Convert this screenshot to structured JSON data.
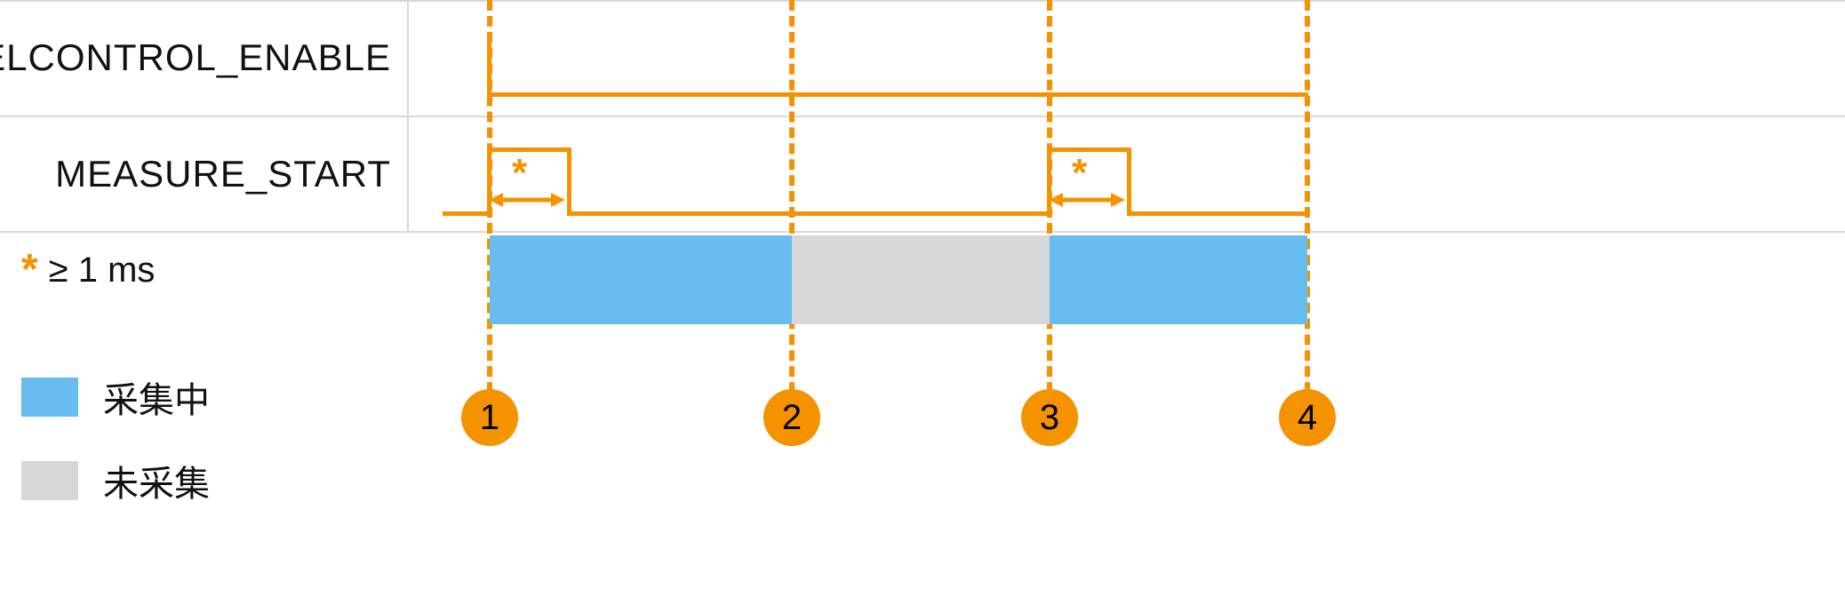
{
  "rows": {
    "levelcontrol_enable": {
      "label": "LEVELCONTROL_ENABLE"
    },
    "measure_start": {
      "label": "MEASURE_START"
    }
  },
  "footnote": {
    "symbol": "*",
    "text": "≥ 1 ms"
  },
  "legend": {
    "collecting": "采集中",
    "not_collecting": "未采集"
  },
  "timepoints": [
    "1",
    "2",
    "3",
    "4"
  ],
  "bars": [
    {
      "from": 1,
      "to": 2,
      "state": "collecting"
    },
    {
      "from": 2,
      "to": 3,
      "state": "not_collecting"
    },
    {
      "from": 3,
      "to": 4,
      "state": "collecting"
    }
  ],
  "pulse_annotation_symbol": "*",
  "chart_data": {
    "type": "timing-diagram",
    "signals": [
      {
        "name": "LEVELCONTROL_ENABLE",
        "events": [
          {
            "at": "before_1",
            "level": "low"
          },
          {
            "at": "1",
            "level": "high"
          },
          {
            "at": "after_4",
            "level": "high"
          }
        ]
      },
      {
        "name": "MEASURE_START",
        "events": [
          {
            "at": "before_1",
            "level": "low"
          },
          {
            "at": "1",
            "level": "high",
            "duration_min_ms": 1
          },
          {
            "at": "1+pulse",
            "level": "low"
          },
          {
            "at": "3",
            "level": "high",
            "duration_min_ms": 1
          },
          {
            "at": "3+pulse",
            "level": "low"
          },
          {
            "at": "after_4",
            "level": "low"
          }
        ]
      }
    ],
    "acquisition_intervals": [
      {
        "from": 1,
        "to": 2,
        "state": "collecting"
      },
      {
        "from": 2,
        "to": 3,
        "state": "not_collecting"
      },
      {
        "from": 3,
        "to": 4,
        "state": "collecting"
      }
    ],
    "pulse_width_constraint": "≥ 1 ms",
    "timepoints": [
      1,
      2,
      3,
      4
    ]
  }
}
